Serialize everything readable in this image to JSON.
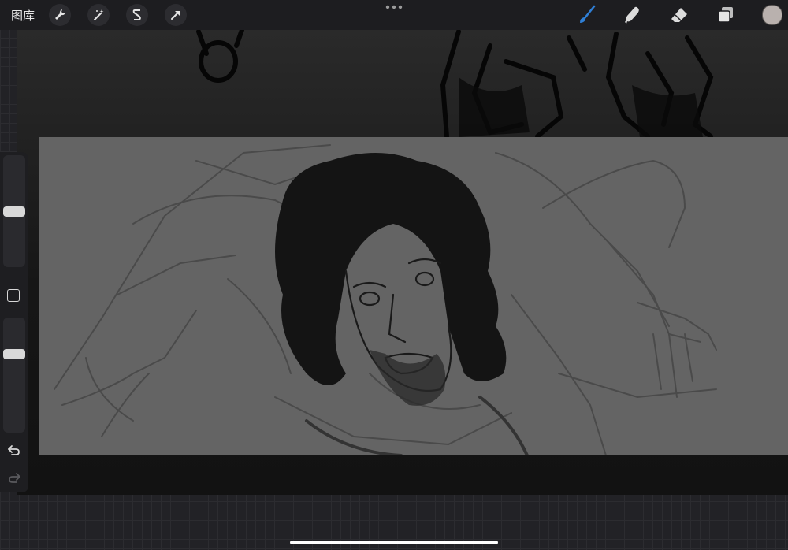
{
  "toolbar": {
    "gallery_label": "图库",
    "left_tools": [
      "wrench-icon",
      "magic-wand-icon",
      "selection-s-icon",
      "transform-arrow-icon"
    ],
    "right_tools": [
      "brush-icon",
      "smudge-icon",
      "eraser-icon",
      "layers-icon"
    ],
    "active_tool": "brush",
    "accent_color": "#2f7fd6",
    "current_color": "#b9b1ae"
  },
  "sidebar": {
    "brush_size_level": 0.5,
    "opacity_level": 0.7
  },
  "canvas": {
    "panel_color": "#646464"
  }
}
